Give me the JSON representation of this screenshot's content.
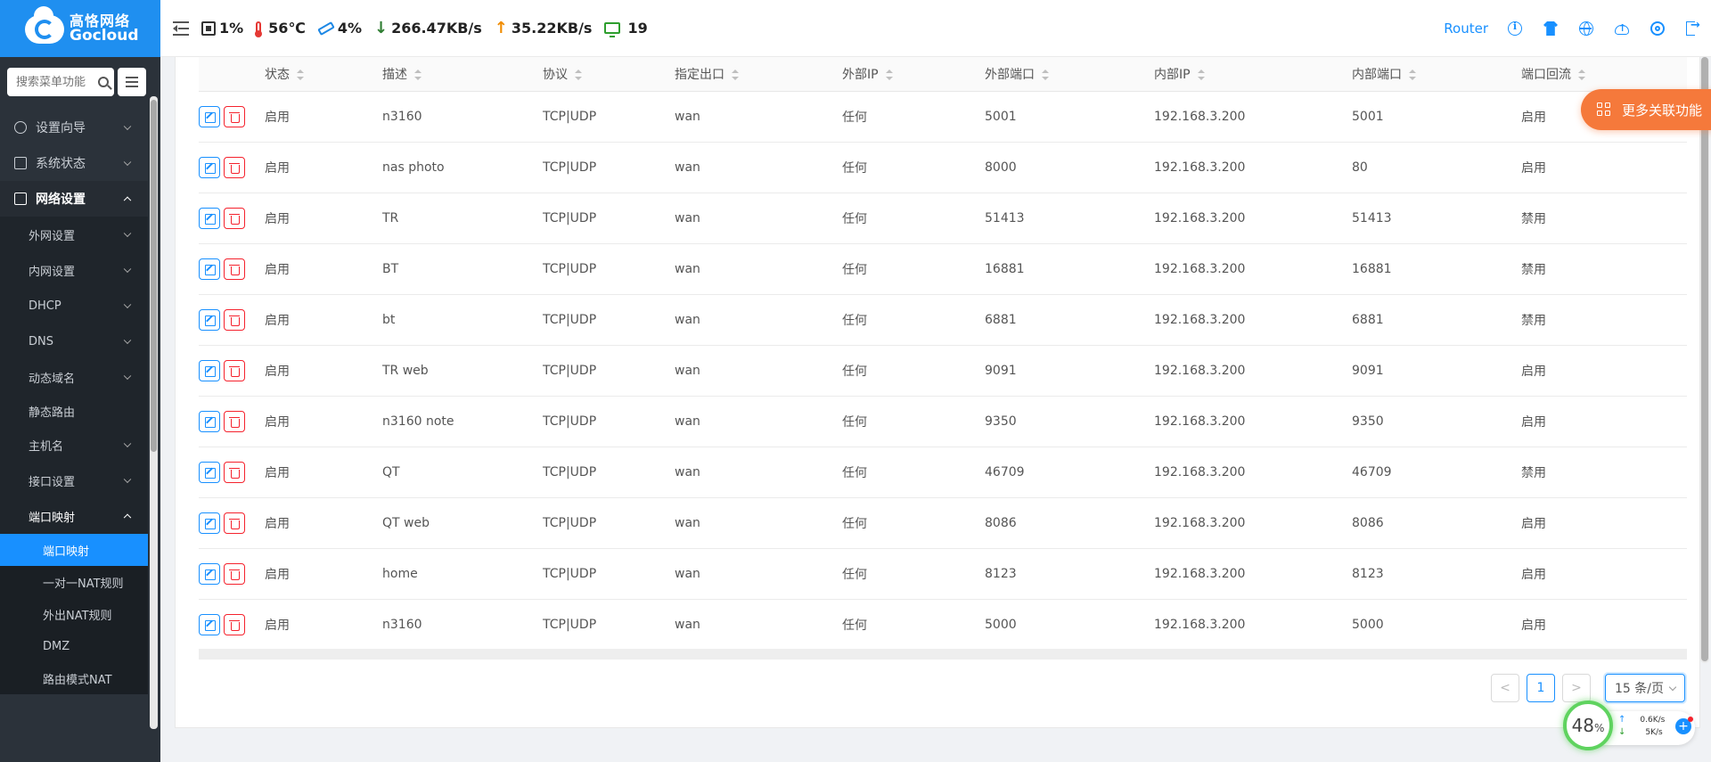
{
  "logo": {
    "cn": "高恪网络",
    "en": "Gocloud"
  },
  "sidebar": {
    "search_placeholder": "搜索菜单功能",
    "menu": [
      {
        "label": "设置向导"
      },
      {
        "label": "系统状态"
      },
      {
        "label": "网络设置"
      }
    ],
    "sub": [
      {
        "label": "外网设置"
      },
      {
        "label": "内网设置"
      },
      {
        "label": "DHCP"
      },
      {
        "label": "DNS"
      },
      {
        "label": "动态域名"
      },
      {
        "label": "静态路由"
      },
      {
        "label": "主机名"
      },
      {
        "label": "接口设置"
      },
      {
        "label": "端口映射"
      }
    ],
    "subsub": [
      {
        "label": "端口映射"
      },
      {
        "label": "一对一NAT规则"
      },
      {
        "label": "外出NAT规则"
      },
      {
        "label": "DMZ"
      },
      {
        "label": "路由模式NAT"
      }
    ]
  },
  "topbar": {
    "cpu": "1%",
    "temp": "56℃",
    "mem": "4%",
    "down": "266.47KB/s",
    "up": "35.22KB/s",
    "devices": "19",
    "router_label": "Router"
  },
  "table": {
    "headers": [
      "状态",
      "描述",
      "协议",
      "指定出口",
      "外部IP",
      "外部端口",
      "内部IP",
      "内部端口",
      "端口回流"
    ],
    "rows": [
      {
        "status": "启用",
        "desc": "n3160",
        "proto": "TCP|UDP",
        "out": "wan",
        "ext_ip": "任何",
        "ext_port": "5001",
        "int_ip": "192.168.3.200",
        "int_port": "5001",
        "loop": "启用"
      },
      {
        "status": "启用",
        "desc": "nas photo",
        "proto": "TCP|UDP",
        "out": "wan",
        "ext_ip": "任何",
        "ext_port": "8000",
        "int_ip": "192.168.3.200",
        "int_port": "80",
        "loop": "启用"
      },
      {
        "status": "启用",
        "desc": "TR",
        "proto": "TCP|UDP",
        "out": "wan",
        "ext_ip": "任何",
        "ext_port": "51413",
        "int_ip": "192.168.3.200",
        "int_port": "51413",
        "loop": "禁用"
      },
      {
        "status": "启用",
        "desc": "BT",
        "proto": "TCP|UDP",
        "out": "wan",
        "ext_ip": "任何",
        "ext_port": "16881",
        "int_ip": "192.168.3.200",
        "int_port": "16881",
        "loop": "禁用"
      },
      {
        "status": "启用",
        "desc": "bt",
        "proto": "TCP|UDP",
        "out": "wan",
        "ext_ip": "任何",
        "ext_port": "6881",
        "int_ip": "192.168.3.200",
        "int_port": "6881",
        "loop": "禁用"
      },
      {
        "status": "启用",
        "desc": "TR web",
        "proto": "TCP|UDP",
        "out": "wan",
        "ext_ip": "任何",
        "ext_port": "9091",
        "int_ip": "192.168.3.200",
        "int_port": "9091",
        "loop": "启用"
      },
      {
        "status": "启用",
        "desc": "n3160 note",
        "proto": "TCP|UDP",
        "out": "wan",
        "ext_ip": "任何",
        "ext_port": "9350",
        "int_ip": "192.168.3.200",
        "int_port": "9350",
        "loop": "启用"
      },
      {
        "status": "启用",
        "desc": "QT",
        "proto": "TCP|UDP",
        "out": "wan",
        "ext_ip": "任何",
        "ext_port": "46709",
        "int_ip": "192.168.3.200",
        "int_port": "46709",
        "loop": "禁用"
      },
      {
        "status": "启用",
        "desc": "QT web",
        "proto": "TCP|UDP",
        "out": "wan",
        "ext_ip": "任何",
        "ext_port": "8086",
        "int_ip": "192.168.3.200",
        "int_port": "8086",
        "loop": "启用"
      },
      {
        "status": "启用",
        "desc": "home",
        "proto": "TCP|UDP",
        "out": "wan",
        "ext_ip": "任何",
        "ext_port": "8123",
        "int_ip": "192.168.3.200",
        "int_port": "8123",
        "loop": "启用"
      },
      {
        "status": "启用",
        "desc": "n3160",
        "proto": "TCP|UDP",
        "out": "wan",
        "ext_ip": "任何",
        "ext_port": "5000",
        "int_ip": "192.168.3.200",
        "int_port": "5000",
        "loop": "启用"
      }
    ]
  },
  "pagination": {
    "prev": "<",
    "page": "1",
    "next": ">",
    "page_size": "15 条/页"
  },
  "more_button": {
    "label": "更多关联功能"
  },
  "speed_widget": {
    "percent": "48",
    "percent_unit": "%",
    "up": "0.6K/s",
    "down": "5K/s",
    "plus": "+"
  },
  "colors": {
    "accent": "#1890ff",
    "sidebar_bg": "#2b323a",
    "logo_bg": "#1f8ff0",
    "more_btn": "#f5793b"
  }
}
